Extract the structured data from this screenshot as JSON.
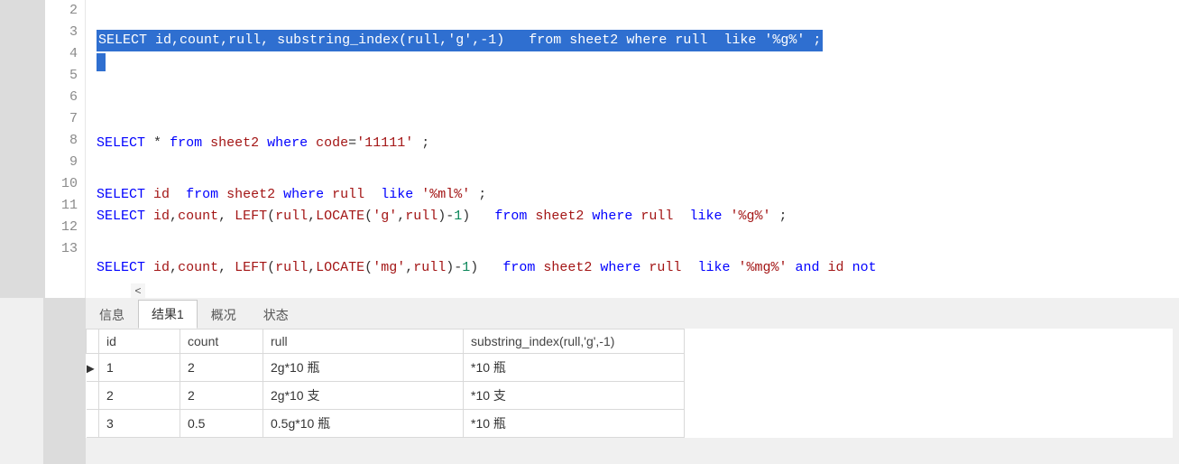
{
  "editor": {
    "selection_line_no": "3",
    "lines": [
      {
        "no": "2",
        "tokens": []
      },
      {
        "no": "3",
        "selected": true,
        "tokens": [
          {
            "c": "kw",
            "t": "SELECT"
          },
          {
            "c": "punc",
            "t": " id"
          },
          {
            "c": "punc",
            "t": ","
          },
          {
            "c": "punc",
            "t": "count"
          },
          {
            "c": "punc",
            "t": ","
          },
          {
            "c": "punc",
            "t": "rull"
          },
          {
            "c": "punc",
            "t": ", "
          },
          {
            "c": "fn",
            "t": "substring_index"
          },
          {
            "c": "punc",
            "t": "("
          },
          {
            "c": "punc",
            "t": "rull"
          },
          {
            "c": "punc",
            "t": ","
          },
          {
            "c": "str",
            "t": "'g'"
          },
          {
            "c": "punc",
            "t": ","
          },
          {
            "c": "punc",
            "t": "-"
          },
          {
            "c": "num",
            "t": "1"
          },
          {
            "c": "punc",
            "t": ")"
          },
          {
            "c": "punc",
            "t": "   "
          },
          {
            "c": "kw",
            "t": "from"
          },
          {
            "c": "punc",
            "t": " sheet2 "
          },
          {
            "c": "kw",
            "t": "where"
          },
          {
            "c": "punc",
            "t": " rull  "
          },
          {
            "c": "kw",
            "t": "like"
          },
          {
            "c": "punc",
            "t": " "
          },
          {
            "c": "str",
            "t": "'%g%'"
          },
          {
            "c": "punc",
            "t": " ;"
          }
        ]
      },
      {
        "no": "4",
        "caret": true,
        "tokens": []
      },
      {
        "no": "5",
        "tokens": []
      },
      {
        "no": "6",
        "tokens": []
      },
      {
        "no": "7",
        "tokens": [
          {
            "c": "kw",
            "t": "SELECT"
          },
          {
            "c": "punc",
            "t": " "
          },
          {
            "c": "star",
            "t": "*"
          },
          {
            "c": "punc",
            "t": " "
          },
          {
            "c": "kw",
            "t": "from"
          },
          {
            "c": "punc",
            "t": " "
          },
          {
            "c": "fn",
            "t": "sheet2"
          },
          {
            "c": "punc",
            "t": " "
          },
          {
            "c": "kw",
            "t": "where"
          },
          {
            "c": "punc",
            "t": " "
          },
          {
            "c": "fn",
            "t": "code"
          },
          {
            "c": "punc",
            "t": "="
          },
          {
            "c": "str",
            "t": "'11111'"
          },
          {
            "c": "punc",
            "t": " ;"
          }
        ]
      },
      {
        "no": "8",
        "tokens": []
      },
      {
        "no": "9",
        "tokens": [
          {
            "c": "kw",
            "t": "SELECT"
          },
          {
            "c": "punc",
            "t": " "
          },
          {
            "c": "fn",
            "t": "id"
          },
          {
            "c": "punc",
            "t": "  "
          },
          {
            "c": "kw",
            "t": "from"
          },
          {
            "c": "punc",
            "t": " "
          },
          {
            "c": "fn",
            "t": "sheet2"
          },
          {
            "c": "punc",
            "t": " "
          },
          {
            "c": "kw",
            "t": "where"
          },
          {
            "c": "punc",
            "t": " "
          },
          {
            "c": "fn",
            "t": "rull"
          },
          {
            "c": "punc",
            "t": "  "
          },
          {
            "c": "kw",
            "t": "like"
          },
          {
            "c": "punc",
            "t": " "
          },
          {
            "c": "str",
            "t": "'%ml%'"
          },
          {
            "c": "punc",
            "t": " ;"
          }
        ]
      },
      {
        "no": "10",
        "tokens": [
          {
            "c": "kw",
            "t": "SELECT"
          },
          {
            "c": "punc",
            "t": " "
          },
          {
            "c": "fn",
            "t": "id"
          },
          {
            "c": "punc",
            "t": ","
          },
          {
            "c": "fn",
            "t": "count"
          },
          {
            "c": "punc",
            "t": ", "
          },
          {
            "c": "fn",
            "t": "LEFT"
          },
          {
            "c": "punc",
            "t": "("
          },
          {
            "c": "fn",
            "t": "rull"
          },
          {
            "c": "punc",
            "t": ","
          },
          {
            "c": "fn",
            "t": "LOCATE"
          },
          {
            "c": "punc",
            "t": "("
          },
          {
            "c": "str",
            "t": "'g'"
          },
          {
            "c": "punc",
            "t": ","
          },
          {
            "c": "fn",
            "t": "rull"
          },
          {
            "c": "punc",
            "t": ")"
          },
          {
            "c": "punc",
            "t": "-"
          },
          {
            "c": "num",
            "t": "1"
          },
          {
            "c": "punc",
            "t": ")"
          },
          {
            "c": "punc",
            "t": "   "
          },
          {
            "c": "kw",
            "t": "from"
          },
          {
            "c": "punc",
            "t": " "
          },
          {
            "c": "fn",
            "t": "sheet2"
          },
          {
            "c": "punc",
            "t": " "
          },
          {
            "c": "kw",
            "t": "where"
          },
          {
            "c": "punc",
            "t": " "
          },
          {
            "c": "fn",
            "t": "rull"
          },
          {
            "c": "punc",
            "t": "  "
          },
          {
            "c": "kw",
            "t": "like"
          },
          {
            "c": "punc",
            "t": " "
          },
          {
            "c": "str",
            "t": "'%g%'"
          },
          {
            "c": "punc",
            "t": " ;"
          }
        ]
      },
      {
        "no": "11",
        "tokens": []
      },
      {
        "no": "12",
        "tokens": [
          {
            "c": "kw",
            "t": "SELECT"
          },
          {
            "c": "punc",
            "t": " "
          },
          {
            "c": "fn",
            "t": "id"
          },
          {
            "c": "punc",
            "t": ","
          },
          {
            "c": "fn",
            "t": "count"
          },
          {
            "c": "punc",
            "t": ", "
          },
          {
            "c": "fn",
            "t": "LEFT"
          },
          {
            "c": "punc",
            "t": "("
          },
          {
            "c": "fn",
            "t": "rull"
          },
          {
            "c": "punc",
            "t": ","
          },
          {
            "c": "fn",
            "t": "LOCATE"
          },
          {
            "c": "punc",
            "t": "("
          },
          {
            "c": "str",
            "t": "'mg'"
          },
          {
            "c": "punc",
            "t": ","
          },
          {
            "c": "fn",
            "t": "rull"
          },
          {
            "c": "punc",
            "t": ")"
          },
          {
            "c": "punc",
            "t": "-"
          },
          {
            "c": "num",
            "t": "1"
          },
          {
            "c": "punc",
            "t": ")"
          },
          {
            "c": "punc",
            "t": "   "
          },
          {
            "c": "kw",
            "t": "from"
          },
          {
            "c": "punc",
            "t": " "
          },
          {
            "c": "fn",
            "t": "sheet2"
          },
          {
            "c": "punc",
            "t": " "
          },
          {
            "c": "kw",
            "t": "where"
          },
          {
            "c": "punc",
            "t": " "
          },
          {
            "c": "fn",
            "t": "rull"
          },
          {
            "c": "punc",
            "t": "  "
          },
          {
            "c": "kw",
            "t": "like"
          },
          {
            "c": "punc",
            "t": " "
          },
          {
            "c": "str",
            "t": "'%mg%'"
          },
          {
            "c": "punc",
            "t": " "
          },
          {
            "c": "kw",
            "t": "and"
          },
          {
            "c": "punc",
            "t": " "
          },
          {
            "c": "fn",
            "t": "id"
          },
          {
            "c": "punc",
            "t": " "
          },
          {
            "c": "kw",
            "t": "not"
          }
        ]
      },
      {
        "no": "13",
        "tokens": []
      }
    ]
  },
  "tabs": {
    "items": [
      {
        "label": "信息",
        "active": false
      },
      {
        "label": "结果1",
        "active": true
      },
      {
        "label": "概况",
        "active": false
      },
      {
        "label": "状态",
        "active": false
      }
    ]
  },
  "result": {
    "columns": [
      "id",
      "count",
      "rull",
      "substring_index(rull,'g',-1)"
    ],
    "current_row_index": 0,
    "rows": [
      {
        "id": "1",
        "count": "2",
        "rull": "2g*10 瓶",
        "sub": "*10 瓶"
      },
      {
        "id": "2",
        "count": "2",
        "rull": "2g*10 支",
        "sub": "*10 支"
      },
      {
        "id": "3",
        "count": "0.5",
        "rull": "0.5g*10 瓶",
        "sub": "*10 瓶"
      }
    ]
  }
}
